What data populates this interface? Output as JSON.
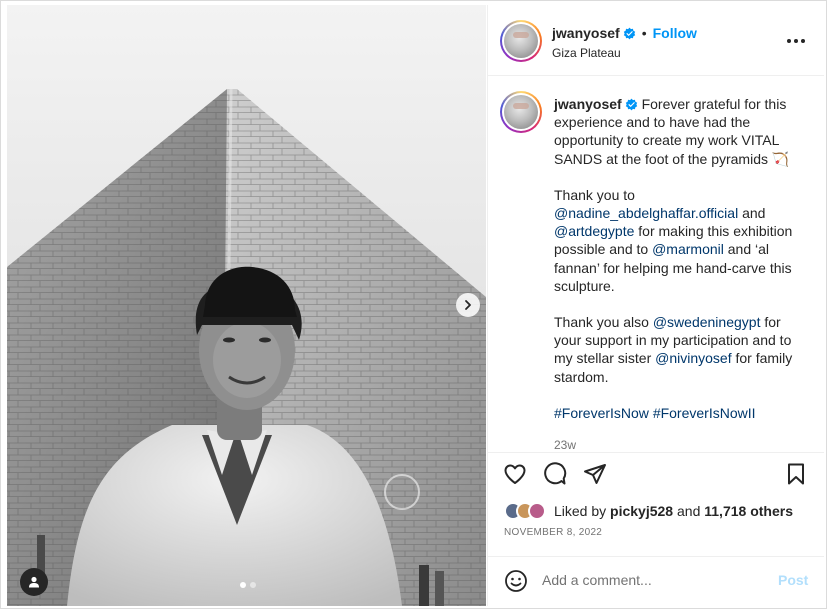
{
  "post": {
    "username": "jwanyosef",
    "follow_label": "Follow",
    "separator": "•",
    "location": "Giza Plateau"
  },
  "caption": {
    "username": "jwanyosef",
    "p1": "Forever grateful for this experience and to have had the opportunity to create my work VITAL SANDS at the foot of the pyramids 🏹",
    "p2_a": "Thank you to ",
    "p2_m1": "@nadine_abdelghaffar.official",
    "p2_b": " and ",
    "p2_m2": "@artdegypte",
    "p2_c": " for making this exhibition possible and to ",
    "p2_m3": "@marmonil",
    "p2_d": " and ‘al fannan’ for helping me hand-carve this sculpture.",
    "p3_a": "Thank you also ",
    "p3_m1": "@swedeninegypt",
    "p3_b": " for your support in my participation and to my stellar sister ",
    "p3_m2": "@nivinyosef",
    "p3_c": " for family stardom.",
    "tag1": "#ForeverIsNow",
    "tag2": "#ForeverIsNowII",
    "time_ago": "23w"
  },
  "likes": {
    "prefix": "Liked by ",
    "user": "pickyj528",
    "and": " and ",
    "count": "11,718 others"
  },
  "date": "NOVEMBER 8, 2022",
  "comment": {
    "placeholder": "Add a comment...",
    "post_label": "Post"
  },
  "media": {
    "image_index": 1,
    "image_count": 2
  },
  "colors": {
    "link": "#0095f6",
    "mention": "#00376b",
    "muted": "#737373"
  },
  "icons": [
    "heart-icon",
    "comment-icon",
    "share-icon",
    "bookmark-icon",
    "more-icon",
    "verified-icon",
    "emoji-icon",
    "chevron-right-icon",
    "user-tag-icon"
  ]
}
